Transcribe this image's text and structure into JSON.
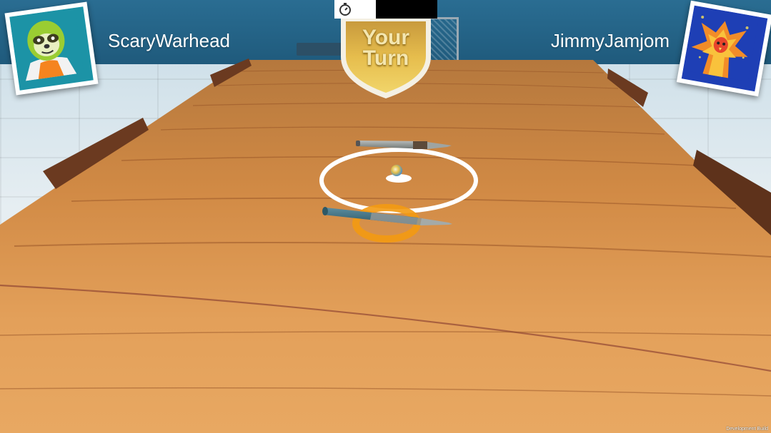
{
  "hud": {
    "player1": {
      "name": "ScaryWarhead",
      "avatar": "sloth-avatar"
    },
    "player2": {
      "name": "JimmyJamjom",
      "avatar": "phoenix-avatar"
    },
    "turn_banner": {
      "line1": "Your",
      "line2": "Turn"
    },
    "timer": {
      "icon": "stopwatch-icon",
      "remaining_fraction": 0.4
    }
  },
  "game": {
    "objects": [
      "wooden-table",
      "pen-player1",
      "pen-player2",
      "ball",
      "center-circle",
      "target-ring"
    ]
  },
  "footer": {
    "build_label": "Development Build"
  },
  "colors": {
    "header_bg": "#1f5a7c",
    "wood": "#d48a3e",
    "ring": "#f39a12",
    "shield": "#e7bf4e"
  }
}
